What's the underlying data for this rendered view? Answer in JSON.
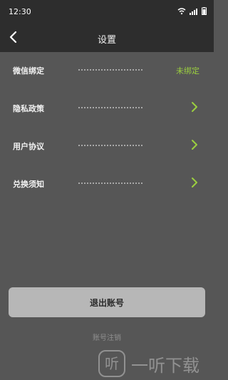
{
  "status_bar": {
    "time": "12:30"
  },
  "header": {
    "title": "设置"
  },
  "settings": {
    "items": [
      {
        "label": "微信绑定",
        "value": "未绑定"
      },
      {
        "label": "隐私政策"
      },
      {
        "label": "用户协议"
      },
      {
        "label": "兑换须知"
      }
    ]
  },
  "actions": {
    "logout": "退出账号",
    "cancel_account": "账号注销"
  },
  "watermark": {
    "badge": "听",
    "text": "一听下载"
  },
  "colors": {
    "accent": "#9bcf3f",
    "background": "#565656",
    "header": "#2d2d2d",
    "button": "#b7b7b7"
  },
  "icons": {
    "status": [
      "wifi-icon",
      "signal-icon",
      "battery-icon"
    ],
    "back": "back-arrow-icon",
    "chevron": "chevron-right-icon"
  }
}
